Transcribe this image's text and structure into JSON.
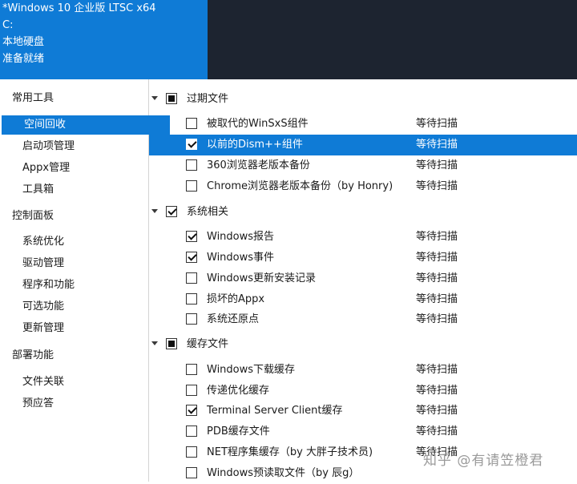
{
  "header": {
    "lines": [
      "*Windows 10 企业版 LTSC x64",
      "C:",
      "本地硬盘",
      "准备就绪"
    ]
  },
  "sidebar": {
    "items": [
      {
        "label": "常用工具",
        "type": "group"
      },
      {
        "label": "空间回收",
        "type": "child",
        "selected": true
      },
      {
        "label": "启动项管理",
        "type": "child"
      },
      {
        "label": "Appx管理",
        "type": "child"
      },
      {
        "label": "工具箱",
        "type": "child"
      },
      {
        "label": "控制面板",
        "type": "group"
      },
      {
        "label": "系统优化",
        "type": "child"
      },
      {
        "label": "驱动管理",
        "type": "child"
      },
      {
        "label": "程序和功能",
        "type": "child"
      },
      {
        "label": "可选功能",
        "type": "child"
      },
      {
        "label": "更新管理",
        "type": "child"
      },
      {
        "label": "部署功能",
        "type": "group"
      },
      {
        "label": "文件关联",
        "type": "child"
      },
      {
        "label": "预应答",
        "type": "child"
      }
    ]
  },
  "tree": {
    "rows": [
      {
        "kind": "group",
        "label": "过期文件",
        "check": "partial"
      },
      {
        "kind": "item",
        "label": "被取代的WinSxS组件",
        "status": "等待扫描",
        "check": "unchecked"
      },
      {
        "kind": "item",
        "label": "以前的Dism++组件",
        "status": "等待扫描",
        "check": "checked",
        "selected": true
      },
      {
        "kind": "item",
        "label": "360浏览器老版本备份",
        "status": "等待扫描",
        "check": "unchecked"
      },
      {
        "kind": "item",
        "label": "Chrome浏览器老版本备份（by Honry)",
        "status": "等待扫描",
        "check": "unchecked"
      },
      {
        "kind": "group",
        "label": "系统相关",
        "check": "checked"
      },
      {
        "kind": "item",
        "label": "Windows报告",
        "status": "等待扫描",
        "check": "checked"
      },
      {
        "kind": "item",
        "label": "Windows事件",
        "status": "等待扫描",
        "check": "checked"
      },
      {
        "kind": "item",
        "label": "Windows更新安装记录",
        "status": "等待扫描",
        "check": "unchecked"
      },
      {
        "kind": "item",
        "label": "损坏的Appx",
        "status": "等待扫描",
        "check": "unchecked"
      },
      {
        "kind": "item",
        "label": "系统还原点",
        "status": "等待扫描",
        "check": "unchecked"
      },
      {
        "kind": "group",
        "label": "缓存文件",
        "check": "partial"
      },
      {
        "kind": "item",
        "label": "Windows下载缓存",
        "status": "等待扫描",
        "check": "unchecked"
      },
      {
        "kind": "item",
        "label": "传递优化缓存",
        "status": "等待扫描",
        "check": "unchecked"
      },
      {
        "kind": "item",
        "label": "Terminal Server Client缓存",
        "status": "等待扫描",
        "check": "checked"
      },
      {
        "kind": "item",
        "label": "PDB缓存文件",
        "status": "等待扫描",
        "check": "unchecked"
      },
      {
        "kind": "item",
        "label": "NET程序集缓存（by 大胖子技术员)",
        "status": "等待扫描",
        "check": "unchecked"
      },
      {
        "kind": "item",
        "label": "Windows预读取文件（by 辰g）",
        "status": "",
        "check": "unchecked"
      }
    ]
  },
  "watermark": "知乎 @有请笠橙君",
  "colors": {
    "accent": "#0f7bd6",
    "header_dark": "#1d2430"
  }
}
